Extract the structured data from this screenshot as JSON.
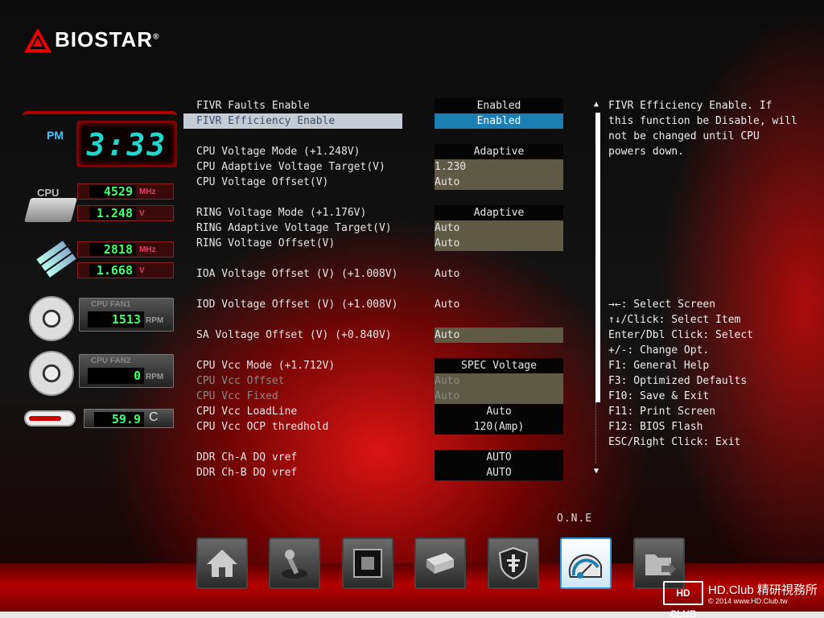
{
  "brand": {
    "name": "BIOSTAR",
    "reg": "®"
  },
  "clock": {
    "ampm": "PM",
    "time": "3:33"
  },
  "monitor": {
    "cpu_label": "CPU",
    "cpu_freq": "4529",
    "cpu_freq_unit": "MHz",
    "cpu_volt": "1.248",
    "cpu_volt_unit": "V",
    "mem_freq": "2818",
    "mem_freq_unit": "MHz",
    "mem_volt": "1.668",
    "mem_volt_unit": "V",
    "fan1_label": "CPU FAN1",
    "fan1_rpm": "1513",
    "fan1_unit": "RPM",
    "fan2_label": "CPU FAN2",
    "fan2_rpm": "0",
    "fan2_unit": "RPM",
    "temp": "59.9",
    "temp_unit": "C"
  },
  "menu": {
    "items": [
      {
        "label": "FIVR Faults Enable",
        "value": "Enabled"
      },
      {
        "label": "FIVR Efficiency Enable",
        "value": "Enabled"
      },
      {
        "label": "CPU Voltage Mode (+1.248V)",
        "value": "Adaptive"
      },
      {
        "label": "CPU Adaptive Voltage Target(V)",
        "value": "1.230"
      },
      {
        "label": "CPU Voltage Offset(V)",
        "value": "Auto"
      },
      {
        "label": "RING Voltage Mode (+1.176V)",
        "value": "Adaptive"
      },
      {
        "label": "RING Adaptive Voltage Target(V)",
        "value": "Auto"
      },
      {
        "label": "RING Voltage Offset(V)",
        "value": "Auto"
      },
      {
        "label": "IOA Voltage Offset (V) (+1.008V)",
        "value": "Auto"
      },
      {
        "label": "IOD Voltage Offset (V) (+1.008V)",
        "value": "Auto"
      },
      {
        "label": "SA Voltage Offset (V) (+0.840V)",
        "value": "Auto"
      },
      {
        "label": "CPU Vcc Mode (+1.712V)",
        "value": "SPEC Voltage"
      },
      {
        "label": "CPU Vcc Offset",
        "value": "Auto"
      },
      {
        "label": "CPU Vcc Fixed",
        "value": "Auto"
      },
      {
        "label": "CPU Vcc LoadLine",
        "value": "Auto"
      },
      {
        "label": "CPU Vcc OCP thredhold",
        "value": "120(Amp)"
      },
      {
        "label": "DDR Ch-A DQ vref",
        "value": "AUTO"
      },
      {
        "label": "DDR Ch-B DQ vref",
        "value": "AUTO"
      }
    ]
  },
  "help": {
    "text": "FIVR Efficiency Enable. If\nthis function be Disable, will\nnot be changed until CPU\npowers down."
  },
  "keys": [
    "→←: Select Screen",
    "↑↓/Click: Select Item",
    "Enter/Dbl Click: Select",
    "+/-: Change Opt.",
    "F1: General Help",
    "F3: Optimized Defaults",
    "F10: Save & Exit",
    "F11: Print Screen",
    "F12: BIOS Flash",
    "ESC/Right Click: Exit"
  ],
  "dock": {
    "active_label": "O.N.E",
    "icons": [
      "home-icon",
      "joystick-icon",
      "chip-icon",
      "drive-icon",
      "shield-icon",
      "speedometer-icon",
      "folder-exit-icon"
    ]
  },
  "watermark": {
    "logo": "HD CLUB",
    "line1": "HD.Club 精研視務所",
    "line2": "© 2014  www.HD.Club.tw"
  }
}
